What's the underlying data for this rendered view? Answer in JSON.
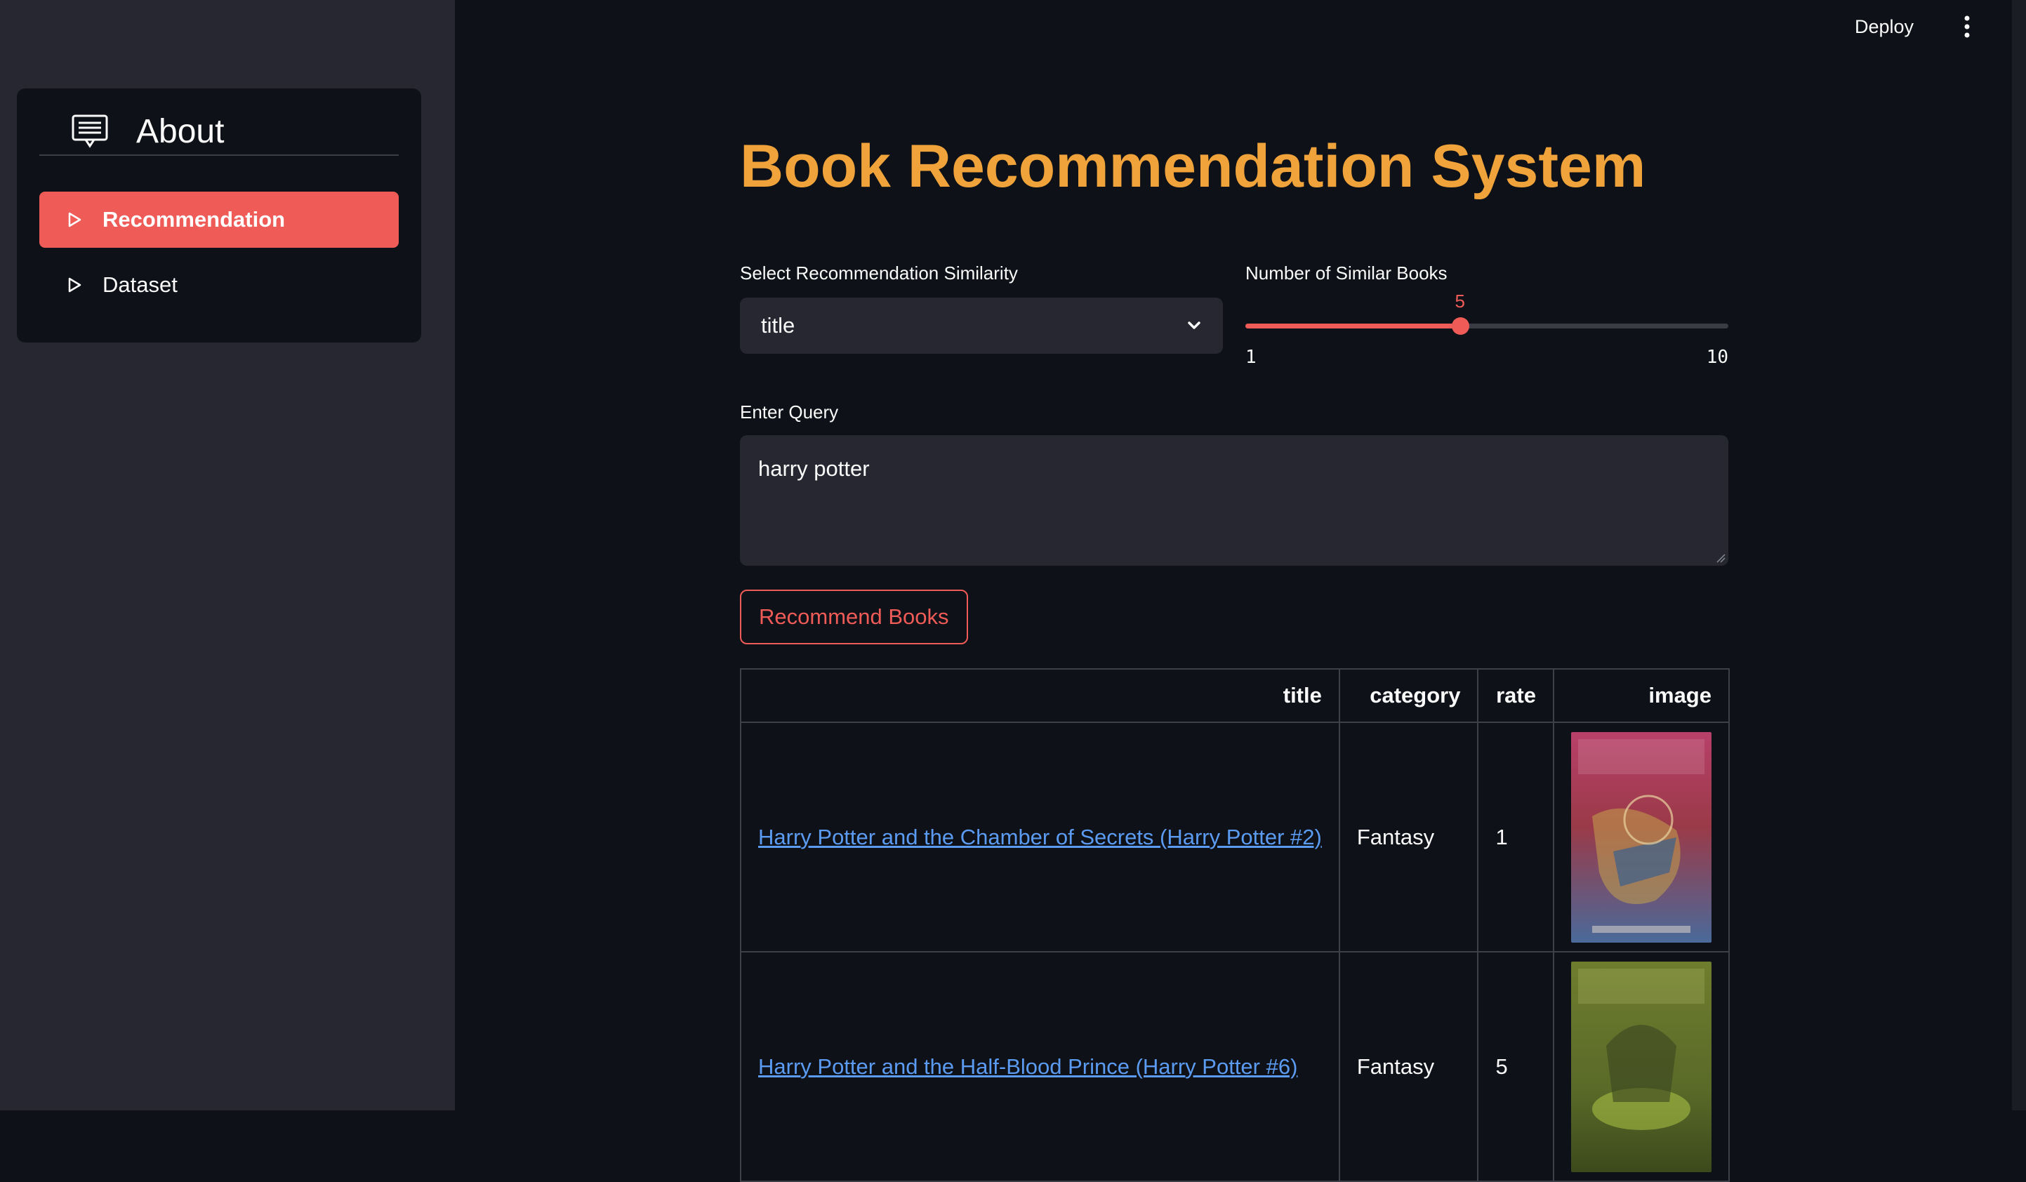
{
  "sidebar": {
    "menu_title": "About",
    "items": [
      {
        "label": "Recommendation",
        "active": true
      },
      {
        "label": "Dataset",
        "active": false
      }
    ]
  },
  "header": {
    "deploy_label": "Deploy",
    "menu_icon": "vertical-ellipsis-icon"
  },
  "main": {
    "title": "Book Recommendation System",
    "similarity": {
      "label": "Select Recommendation Similarity",
      "value": "title"
    },
    "num_books": {
      "label": "Number of Similar Books",
      "value": 5,
      "min": 1,
      "max": 10,
      "value_text": "5",
      "min_text": "1",
      "max_text": "10"
    },
    "query": {
      "label": "Enter Query",
      "value": "harry potter"
    },
    "recommend_button": "Recommend Books",
    "table": {
      "headers": [
        "title",
        "category",
        "rate",
        "image"
      ],
      "rows": [
        {
          "title": "Harry Potter and the Chamber of Secrets (Harry Potter #2)",
          "category": "Fantasy",
          "rate": "1",
          "image": "cover-chamber-of-secrets"
        },
        {
          "title": "Harry Potter and the Half-Blood Prince (Harry Potter #6)",
          "category": "Fantasy",
          "rate": "5",
          "image": "cover-half-blood-prince"
        }
      ]
    }
  },
  "colors": {
    "accent": "#ef5b57",
    "title": "#f0a33a",
    "link": "#5b9bf2",
    "background": "#0e1117",
    "sidebar": "#262730"
  }
}
